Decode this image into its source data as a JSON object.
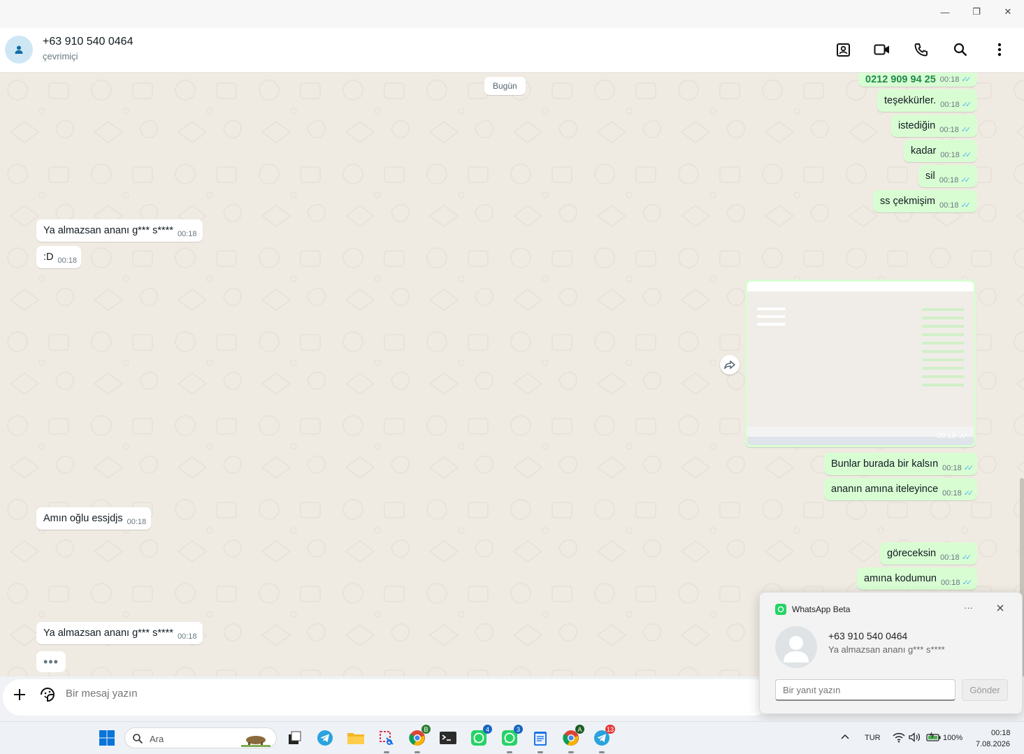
{
  "window": {
    "minimize": "—",
    "maximize": "❐",
    "close": "✕"
  },
  "header": {
    "contact_name": "+63 910 540 0464",
    "status": "çevrimiçi"
  },
  "chat": {
    "day_label": "Bugün",
    "messages": [
      {
        "dir": "out",
        "text": "0212 909 94 25",
        "time": "00:18"
      },
      {
        "dir": "out",
        "text": "teşekkürler.",
        "time": "00:18"
      },
      {
        "dir": "out",
        "text": "istediğin",
        "time": "00:18"
      },
      {
        "dir": "out",
        "text": "kadar",
        "time": "00:18"
      },
      {
        "dir": "out",
        "text": "sil",
        "time": "00:18"
      },
      {
        "dir": "out",
        "text": "ss çekmişim",
        "time": "00:18"
      },
      {
        "dir": "in",
        "text": "Ya almazsan ananı g*** s****",
        "time": "00:18"
      },
      {
        "dir": "in",
        "text": ":D",
        "time": "00:18"
      },
      {
        "dir": "out",
        "text": "Bunlar burada bir kalsın",
        "time": "00:18"
      },
      {
        "dir": "out",
        "text": "ananın amına iteleyince",
        "time": "00:18"
      },
      {
        "dir": "in",
        "text": "Amın oğlu essjdjs",
        "time": "00:18"
      },
      {
        "dir": "out",
        "text": "göreceksin",
        "time": "00:18"
      },
      {
        "dir": "out",
        "text": "amına kodumun",
        "time": "00:18"
      },
      {
        "dir": "in",
        "text": "Ya almazsan ananı g*** s****",
        "time": "00:18"
      }
    ],
    "image_time": "00:18",
    "typing": "•••"
  },
  "compose": {
    "placeholder": "Bir mesaj yazın"
  },
  "toast": {
    "app": "WhatsApp Beta",
    "more": "···",
    "sender": "+63 910 540 0464",
    "text": "Ya almazsan ananı g*** s****",
    "reply_placeholder": "Bir yanıt yazın",
    "send": "Gönder"
  },
  "taskbar": {
    "search_placeholder": "Ara",
    "badges": {
      "chrome_b": "B",
      "whatsapp1": "4",
      "whatsapp2": "3",
      "chrome_a": "A",
      "telegram2": "13"
    },
    "lang": "TUR",
    "battery": "100%",
    "time": "00:18",
    "date": "7.08.2026"
  },
  "colors": {
    "outgoing": "#d9fdd3",
    "incoming": "#ffffff",
    "accent": "#25d366",
    "ticks": "#53bdeb"
  }
}
